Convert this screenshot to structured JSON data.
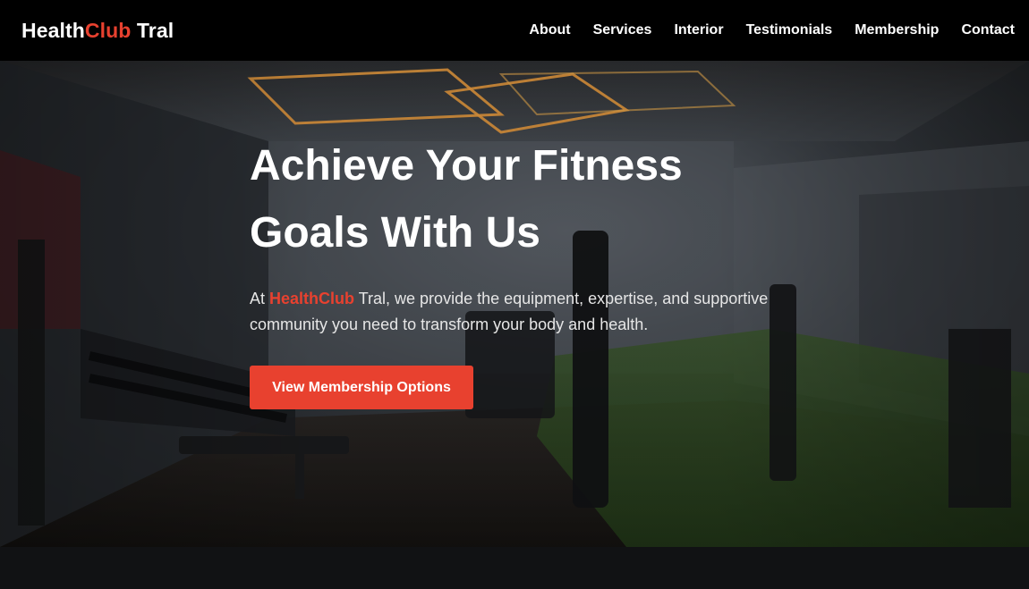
{
  "brand": {
    "part1": "Health",
    "part2": "Club",
    "part3": " Tral"
  },
  "nav": {
    "items": [
      {
        "label": "About"
      },
      {
        "label": "Services"
      },
      {
        "label": "Interior"
      },
      {
        "label": "Testimonials"
      },
      {
        "label": "Membership"
      },
      {
        "label": "Contact"
      }
    ]
  },
  "hero": {
    "title_line1": "Achieve Your Fitness",
    "title_line2": "Goals With Us",
    "text_prefix": "At ",
    "text_brand": "HealthClub",
    "text_suffix": " Tral, we provide the equipment, expertise, and supportive community you need to transform your body and health.",
    "cta_label": "View Membership Options"
  },
  "colors": {
    "accent": "#e8412f",
    "nav_bg": "#000000",
    "page_bg": "#111214"
  }
}
